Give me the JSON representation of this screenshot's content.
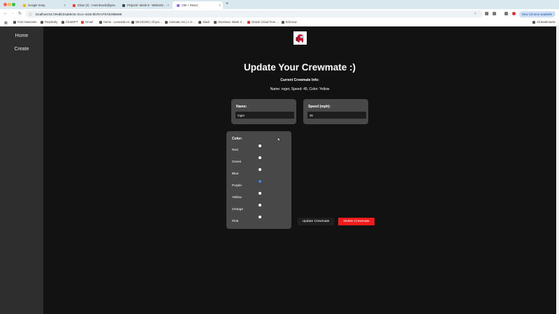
{
  "browser": {
    "tabs": [
      {
        "label": "Google Keep",
        "active": false
      },
      {
        "label": "Inbox (2) - mnnnkcode@gm…",
        "active": false
      },
      {
        "label": "Projects: Week 8 - WEB102 …",
        "active": false
      },
      {
        "label": "Vite + React",
        "active": true
      }
    ],
    "url": "localhost:5173/edit/21ab0c0c-2ccc-4c82-bb76-0797dc098e98",
    "new_chrome_label": "New Chrome available",
    "bookmarks": [
      "Font Awesome",
      "Perplexity",
      "ChatGPT",
      "Gmail",
      "Home - Leonardo.Ai",
      "DEVICON | All pro…",
      "Animate.css | A cr…",
      "Slack",
      "Overview: Week 2…",
      "Oracle Cloud Free…",
      "bolt.new"
    ],
    "all_bookmarks_label": "All Bookmarks"
  },
  "sidebar": {
    "home_label": "Home",
    "create_label": "Create"
  },
  "page": {
    "title": "Update Your Crewmate :)",
    "info_heading": "Current Crewmate Info:",
    "info_text": "Name: roger, Speed: 45, Color: Yellow"
  },
  "form": {
    "name_label": "Name:",
    "name_value": "roger",
    "speed_label": "Speed (mph):",
    "speed_value": "45",
    "color_label": "Color:",
    "colors": [
      "Red",
      "Green",
      "Blue",
      "Purple",
      "Yellow",
      "Orange",
      "Pink"
    ],
    "checked_index": 3
  },
  "actions": {
    "update_label": "Update Crewmate",
    "delete_label": "Delete Crewmate"
  },
  "colors": {
    "sidebar_bg": "#2e2e2e",
    "main_bg": "#121212",
    "card_bg": "#484848",
    "delete_red": "#f01c1c",
    "crewmate_red": "#c8102e"
  }
}
